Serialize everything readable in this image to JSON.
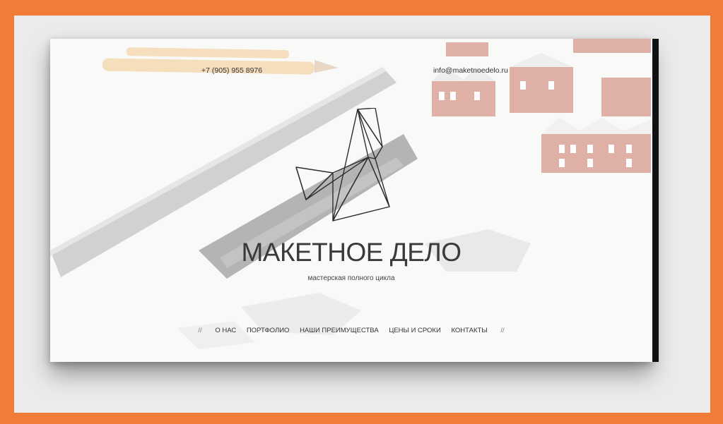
{
  "header": {
    "phone": "+7 (905) 955 8976",
    "email": "info@maketnoedelo.ru"
  },
  "hero": {
    "brand": "МАКЕТНОЕ ДЕЛО",
    "tagline": "мастерская полного цикла"
  },
  "nav": {
    "separator_left": "//",
    "separator_right": "//",
    "items": [
      {
        "label": "О НАС"
      },
      {
        "label": "ПОРТФОЛИО"
      },
      {
        "label": "НАШИ ПРЕИМУЩЕСТВА"
      },
      {
        "label": "ЦЕНЫ И СРОКИ"
      },
      {
        "label": "КОНТАКТЫ"
      }
    ]
  },
  "colors": {
    "frame_accent": "#f07c38",
    "brick": "#b8523a"
  }
}
